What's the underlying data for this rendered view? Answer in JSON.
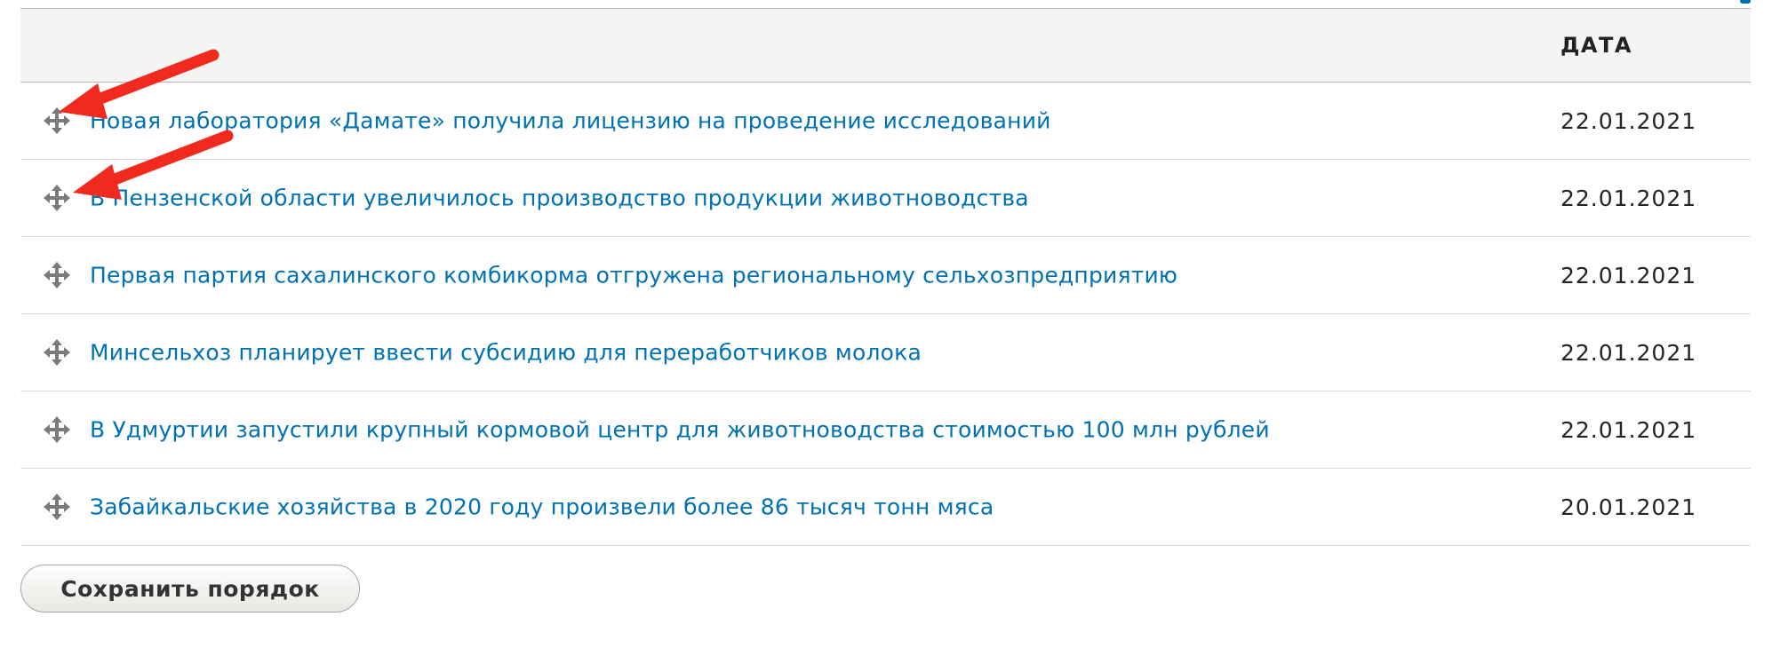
{
  "table": {
    "header": {
      "title_label": "",
      "date_label": "ДАТА"
    },
    "rows": [
      {
        "title": "Новая лаборатория «Дамате» получила лицензию на проведение исследований",
        "date": "22.01.2021"
      },
      {
        "title": "В Пензенской области увеличилось производство продукции животноводства",
        "date": "22.01.2021"
      },
      {
        "title": "Первая партия сахалинского комбикорма отгружена региональному сельхозпредприятию",
        "date": "22.01.2021"
      },
      {
        "title": "Минсельхоз планирует ввести субсидию для переработчиков молока",
        "date": "22.01.2021"
      },
      {
        "title": "В Удмуртии запустили крупный кормовой центр для животноводства стоимостью 100 млн рублей",
        "date": "22.01.2021"
      },
      {
        "title": "Забайкальские хозяйства в 2020 году произвели более 86 тысяч тонн мяса",
        "date": "20.01.2021"
      }
    ]
  },
  "actions": {
    "save_label": "Сохранить порядок"
  },
  "icons": {
    "drag_handle": "drag-handle-icon",
    "annotation": "red-arrow-icon"
  },
  "colors": {
    "link": "#0071b3",
    "header_bg": "#f4f4f2",
    "annotation_arrow": "#f02a1f"
  }
}
